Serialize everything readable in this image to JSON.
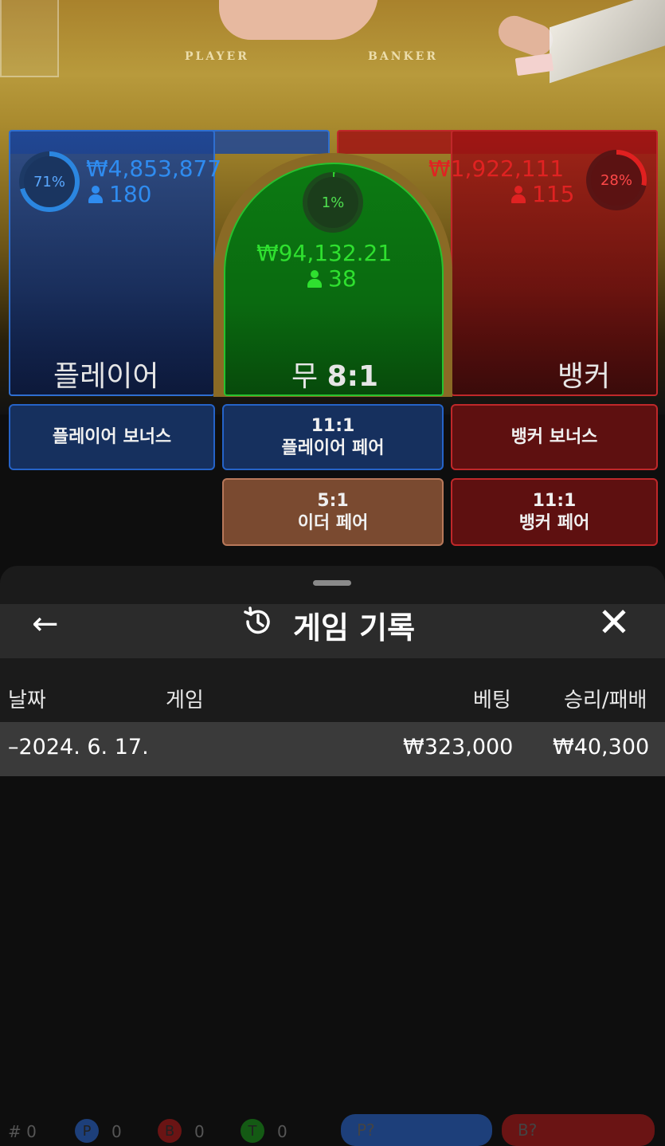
{
  "table": {
    "player_label": "PLAYER",
    "banker_label": "BANKER"
  },
  "bets": {
    "player": {
      "percent": "71%",
      "percent_value": 71,
      "amount": "₩4,853,877",
      "players": "180",
      "label": "플레이어",
      "color": "#2f8cf0"
    },
    "tie": {
      "percent": "1%",
      "percent_value": 1,
      "amount": "₩94,132.21",
      "players": "38",
      "label": "무",
      "payout": "8:1",
      "color": "#2fe02f"
    },
    "banker": {
      "percent": "28%",
      "percent_value": 28,
      "amount": "₩1,922,111",
      "players": "115",
      "label": "뱅커",
      "color": "#e02222"
    }
  },
  "side_bets": {
    "player_bonus": "플레이어 보너스",
    "player_pair_odds": "11:1",
    "player_pair": "플레이어 페어",
    "banker_bonus": "뱅커 보너스",
    "either_pair_odds": "5:1",
    "either_pair": "이더 페어",
    "banker_pair_odds": "11:1",
    "banker_pair": "뱅커 페어"
  },
  "roadmap": {
    "hash": "#",
    "hash_count": "0",
    "p_symbol": "P",
    "p_count": "0",
    "b_symbol": "B",
    "b_count": "0",
    "t_symbol": "T",
    "t_count": "0",
    "p_predict": "P?",
    "b_predict": "B?"
  },
  "history_sheet": {
    "title": "게임 기록",
    "back_icon": "←",
    "close_icon": "✕",
    "columns": {
      "date": "날짜",
      "game": "게임",
      "bet": "베팅",
      "win_loss": "승리/패배"
    },
    "rows": [
      {
        "date": "–2024. 6. 17.",
        "game": "",
        "bet": "₩323,000",
        "win_loss": "₩40,300"
      }
    ]
  }
}
